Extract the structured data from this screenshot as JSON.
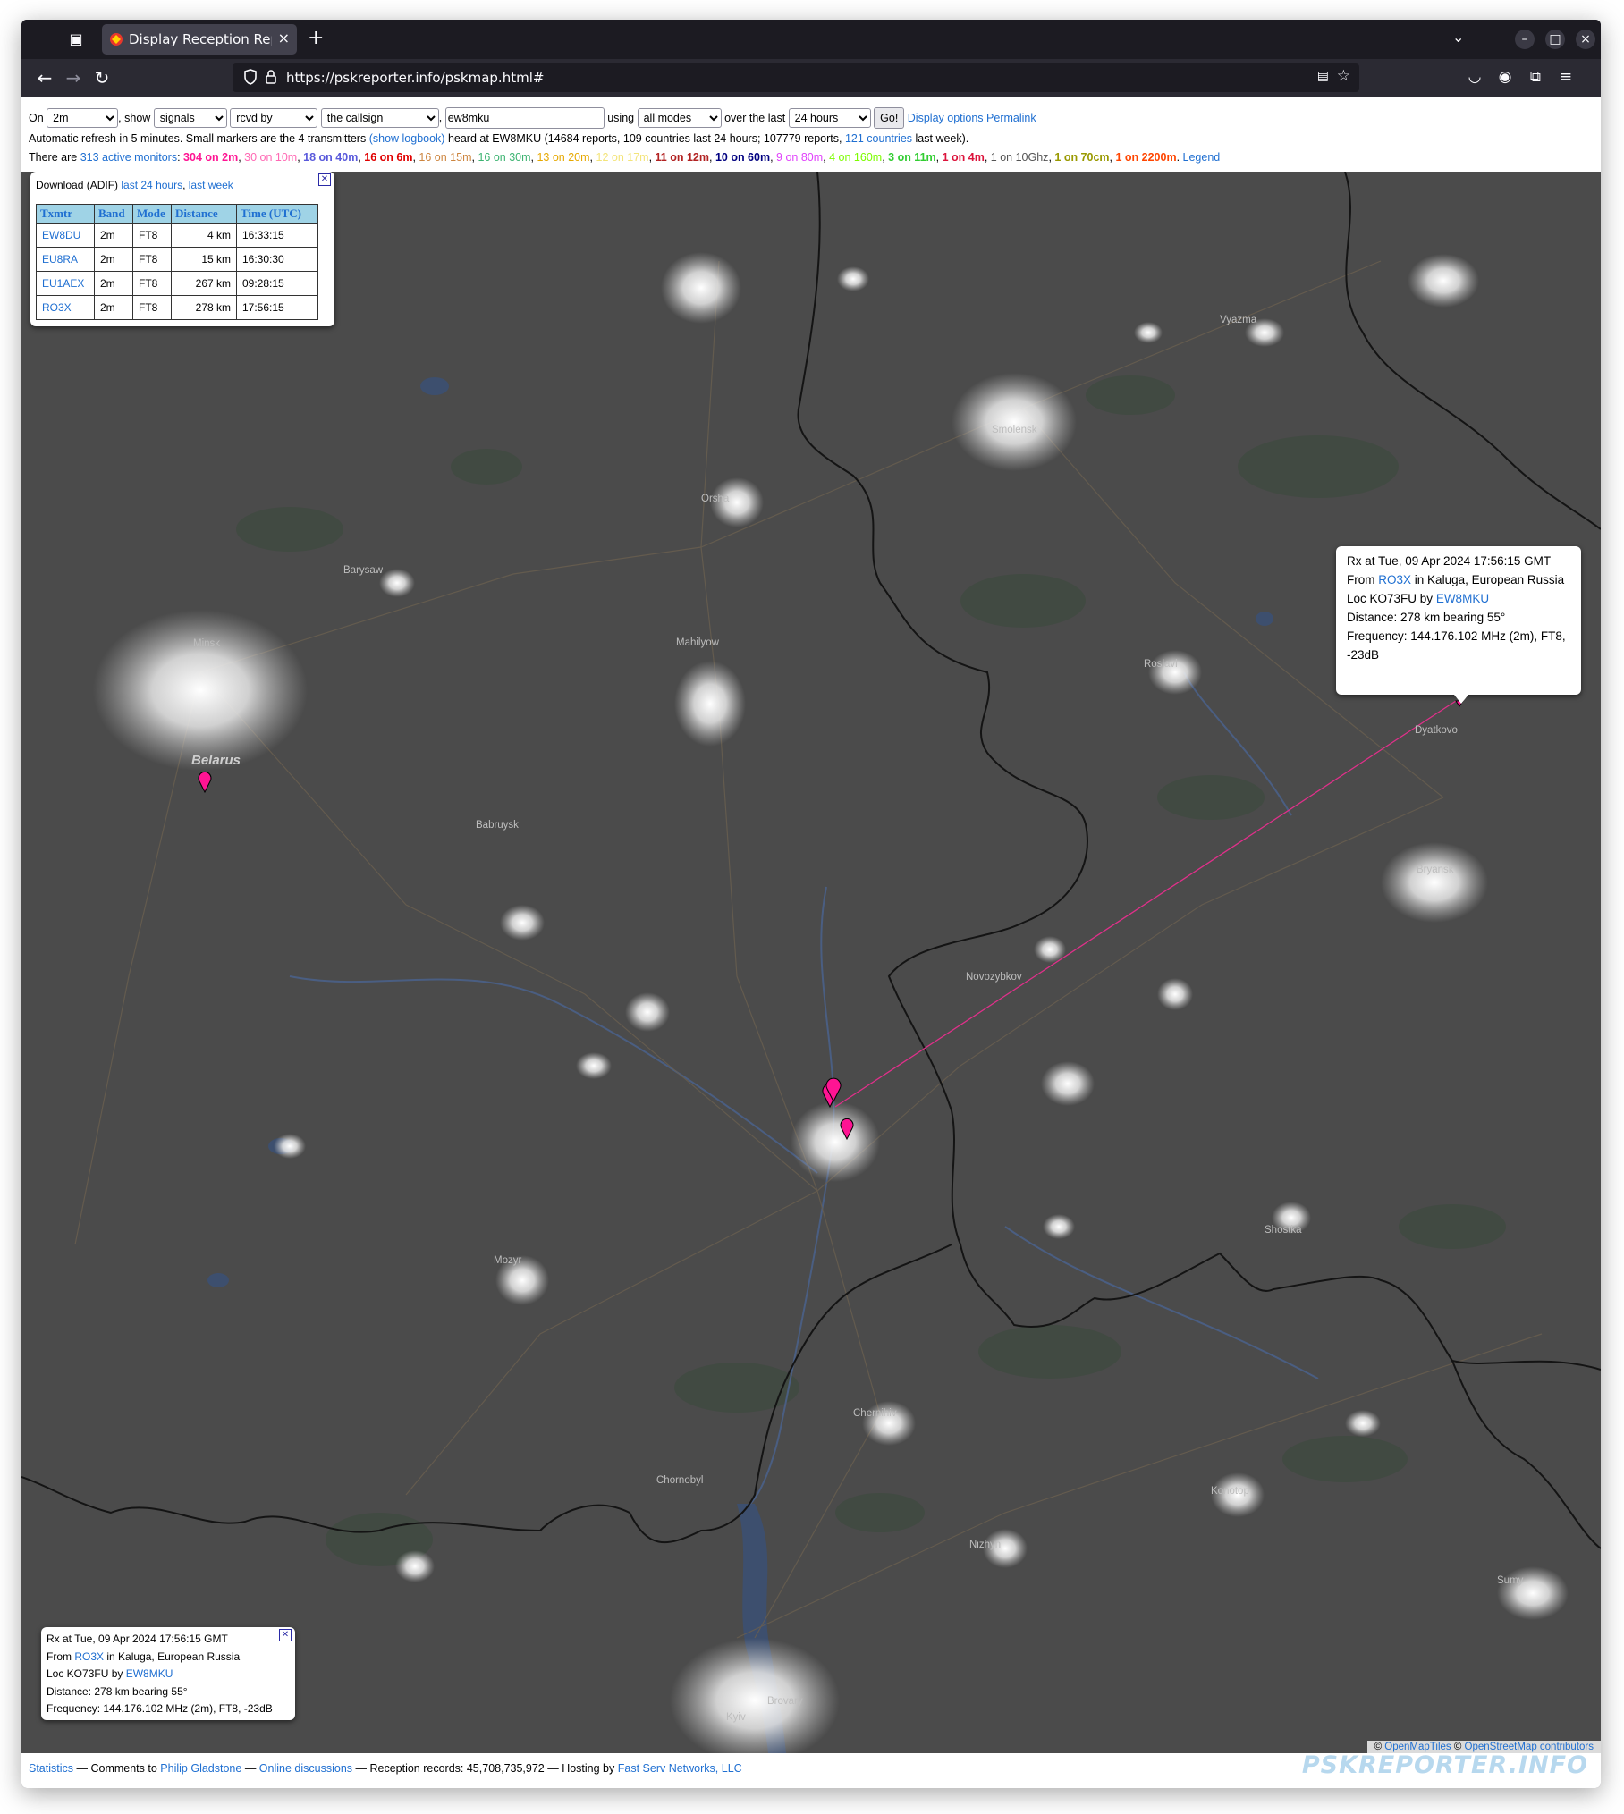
{
  "browser": {
    "tab_title": "Display Reception Reports",
    "url": "https://pskreporter.info/pskmap.html#"
  },
  "controls": {
    "on_label": "On",
    "band_value": "2m",
    "show_label": ", show",
    "show_value": "signals",
    "direction_value": "rcvd by",
    "who_value": "the callsign",
    "callsign_value": "ew8mku",
    "using_label": "using",
    "mode_value": "all modes",
    "over_label": "over the last",
    "period_value": "24 hours",
    "go_label": "Go!",
    "display_options": "Display options",
    "permalink": "Permalink"
  },
  "info": {
    "refresh_pre": "Automatic refresh in 5 minutes. Small markers are the 4 transmitters",
    "show_logbook": "(show logbook)",
    "refresh_post": "heard at EW8MKU (14684 reports, 109 countries last 24 hours; 107779 reports,",
    "countries_link": "121 countries",
    "refresh_end": "last week).",
    "monitors_pre": "There are",
    "monitors_link": "313 active monitors",
    "monitors_colon": ":",
    "bands": [
      {
        "text": "304 on 2m",
        "color": "#ff1493",
        "bold": true
      },
      {
        "text": "30 on 10m",
        "color": "#ff69b4",
        "bold": false
      },
      {
        "text": "18 on 40m",
        "color": "#5a5adb",
        "bold": true
      },
      {
        "text": "16 on 6m",
        "color": "#e00000",
        "bold": true
      },
      {
        "text": "16 on 15m",
        "color": "#cd853f",
        "bold": false
      },
      {
        "text": "16 on 30m",
        "color": "#3cb371",
        "bold": false
      },
      {
        "text": "13 on 20m",
        "color": "#e6a800",
        "bold": false
      },
      {
        "text": "12 on 17m",
        "color": "#f3e47a",
        "bold": false
      },
      {
        "text": "11 on 12m",
        "color": "#b22222",
        "bold": true
      },
      {
        "text": "10 on 60m",
        "color": "#000080",
        "bold": true
      },
      {
        "text": "9 on 80m",
        "color": "#e040fb",
        "bold": false
      },
      {
        "text": "4 on 160m",
        "color": "#7cfc00",
        "bold": false
      },
      {
        "text": "3 on 11m",
        "color": "#32cd32",
        "bold": true
      },
      {
        "text": "1 on 4m",
        "color": "#dc143c",
        "bold": true
      },
      {
        "text": "1 on 10Ghz",
        "color": "#555555",
        "bold": false
      },
      {
        "text": "1 on 70cm",
        "color": "#999900",
        "bold": true
      },
      {
        "text": "1 on 2200m",
        "color": "#ff4500",
        "bold": true
      }
    ],
    "legend_link": "Legend"
  },
  "download": {
    "label": "Download (ADIF)",
    "last24": "last 24 hours",
    "lastweek": "last week",
    "columns": [
      "Txmtr",
      "Band",
      "Mode",
      "Distance",
      "Time (UTC)"
    ],
    "rows": [
      {
        "call": "EW8DU",
        "band": "2m",
        "mode": "FT8",
        "distance": "4 km",
        "time": "16:33:15"
      },
      {
        "call": "EU8RA",
        "band": "2m",
        "mode": "FT8",
        "distance": "15 km",
        "time": "16:30:30"
      },
      {
        "call": "EU1AEX",
        "band": "2m",
        "mode": "FT8",
        "distance": "267 km",
        "time": "09:28:15"
      },
      {
        "call": "RO3X",
        "band": "2m",
        "mode": "FT8",
        "distance": "278 km",
        "time": "17:56:15"
      }
    ]
  },
  "bubble": {
    "rx": "Rx at Tue, 09 Apr 2024 17:56:15 GMT",
    "from_pre": "From",
    "from_call": "RO3X",
    "from_post": "in Kaluga, European Russia",
    "loc_pre": "Loc KO73FU by",
    "loc_call": "EW8MKU",
    "distance": "Distance: 278 km bearing 55°",
    "frequency": "Frequency: 144.176.102 MHz (2m), FT8, -23dB"
  },
  "small_popup": {
    "rx": "Rx at Tue, 09 Apr 2024 17:56:15 GMT",
    "from_pre": "From",
    "from_call": "RO3X",
    "from_post": "in Kaluga, European Russia",
    "loc_pre": "Loc KO73FU by",
    "loc_call": "EW8MKU",
    "distance": "Distance: 278 km bearing 55°",
    "frequency": "Frequency: 144.176.102 MHz (2m), FT8, -23dB"
  },
  "map": {
    "labels": [
      "Minsk",
      "Belarus",
      "Babruysk",
      "Mahilyow",
      "Orsha",
      "Smolensk",
      "Novozybkov",
      "Chernihiv",
      "Chornobyl",
      "Kyiv",
      "Brovary",
      "Bryansk",
      "Dyatkovo",
      "Roslavl",
      "Nizhyn",
      "Konotop",
      "Sumy",
      "Mozyr",
      "Shostka",
      "Barysaw",
      "Vyazma"
    ],
    "attribution_pre": "©",
    "attribution_omt": "OpenMapTiles",
    "attribution_mid": "©",
    "attribution_osm": "OpenStreetMap contributors"
  },
  "footer": {
    "statistics": "Statistics",
    "comments": "— Comments to",
    "author": "Philip Gladstone",
    "dash1": "—",
    "online": "Online discussions",
    "records": "— Reception records: 45,708,735,972 — Hosting by",
    "hosting": "Fast Serv Networks, LLC",
    "brand": "PSKREPORTER.INFO"
  },
  "colors": {
    "map_background": "#4b4b4b",
    "marker": "#ff1493",
    "link": "#1f6fd1"
  }
}
